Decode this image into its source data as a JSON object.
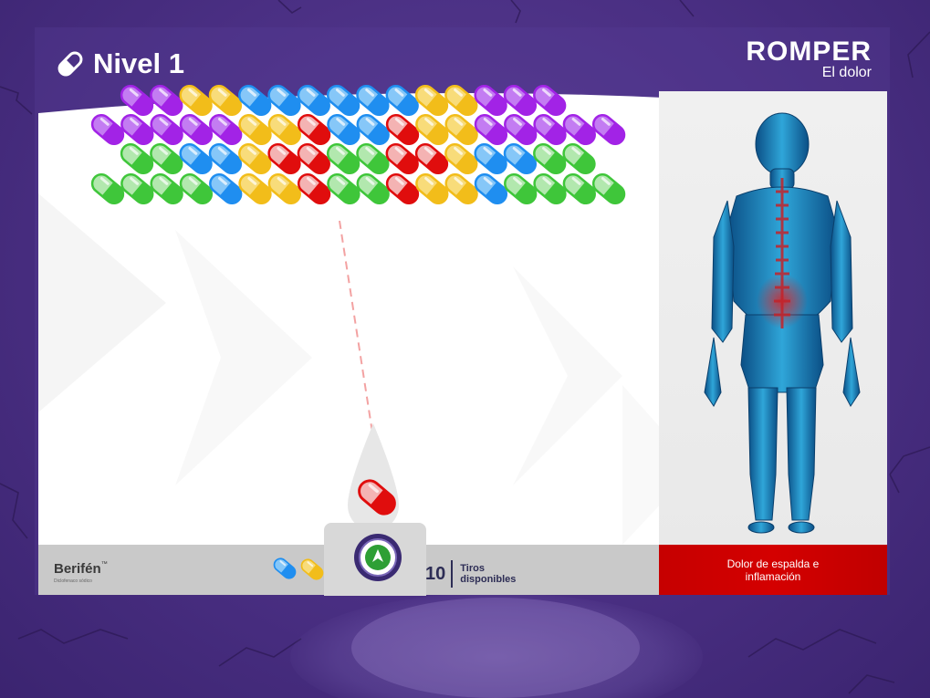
{
  "header": {
    "level_label": "Nivel 1",
    "level_icon": "pill-icon"
  },
  "brand": {
    "line1": "ROMPER",
    "line2": "El dolor"
  },
  "footer": {
    "logo_name": "Berifén",
    "logo_tm": "™",
    "logo_sub": "Diclofenaco sódico",
    "shots_count": "10",
    "shots_label_line1": "Tiros",
    "shots_label_line2": "disponibles"
  },
  "target": {
    "text": "Dolor de espalda e inflamación"
  },
  "colors": {
    "purple": "#a223e6",
    "yellow": "#f2bd1a",
    "blue": "#1f8ef0",
    "red": "#e00d0d",
    "green": "#3fc63a",
    "bg": "#4a2f83",
    "target": "#cc0000"
  },
  "game": {
    "loaded_pill": "red",
    "queue": [
      "blue",
      "yellow"
    ],
    "grid": [
      [
        "purple",
        "purple",
        "yellow",
        "yellow",
        "blue",
        "blue",
        "blue",
        "blue",
        "blue",
        "blue",
        "yellow",
        "yellow",
        "purple",
        "purple",
        "purple"
      ],
      [
        "purple",
        "purple",
        "purple",
        "purple",
        "purple",
        "yellow",
        "yellow",
        "red",
        "blue",
        "blue",
        "red",
        "yellow",
        "yellow",
        "purple",
        "purple",
        "purple",
        "purple",
        "purple"
      ],
      [
        "green",
        "green",
        "blue",
        "blue",
        "yellow",
        "red",
        "red",
        "green",
        "green",
        "red",
        "red",
        "yellow",
        "blue",
        "blue",
        "green",
        "green"
      ],
      [
        "green",
        "green",
        "green",
        "green",
        "blue",
        "yellow",
        "yellow",
        "red",
        "green",
        "green",
        "red",
        "yellow",
        "yellow",
        "blue",
        "green",
        "green",
        "green",
        "green"
      ]
    ]
  }
}
